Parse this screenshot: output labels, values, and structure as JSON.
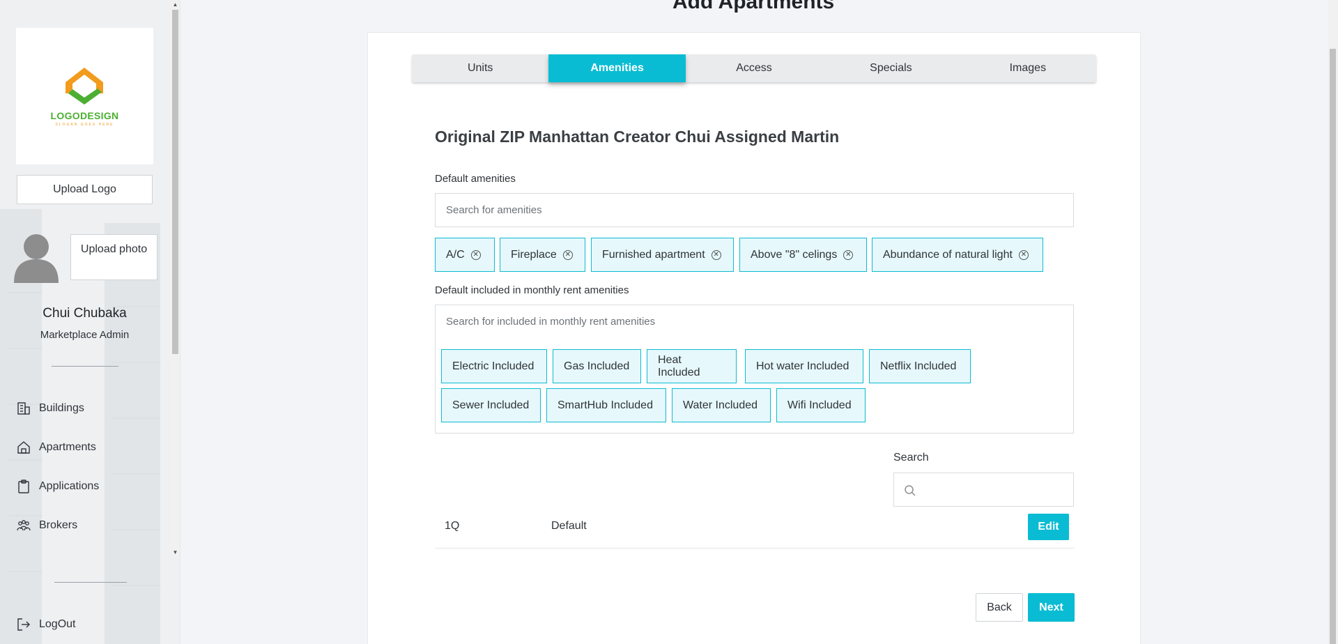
{
  "sidebar": {
    "logo": {
      "text": "LOGODESIGN",
      "sub": "SLOGAN GOES HERE"
    },
    "upload_logo_label": "Upload Logo",
    "upload_photo_label": "Upload photo",
    "user_name": "Chui Chubaka",
    "user_role": "Marketplace Admin",
    "nav": [
      {
        "label": "Buildings",
        "icon": "building-icon"
      },
      {
        "label": "Apartments",
        "icon": "home-icon"
      },
      {
        "label": "Applications",
        "icon": "clipboard-icon"
      },
      {
        "label": "Brokers",
        "icon": "people-icon"
      }
    ],
    "logout_label": "LogOut"
  },
  "page": {
    "title": "Add Apartments",
    "tabs": [
      {
        "label": "Units",
        "active": false
      },
      {
        "label": "Amenities",
        "active": true
      },
      {
        "label": "Access",
        "active": false
      },
      {
        "label": "Specials",
        "active": false
      },
      {
        "label": "Images",
        "active": false
      }
    ],
    "section_title": "Original ZIP Manhattan Creator Chui Assigned Martin",
    "default_amenities": {
      "label": "Default amenities",
      "placeholder": "Search for amenities",
      "chips": [
        "A/C",
        "Fireplace",
        "Furnished apartment",
        "Above \"8\" celings",
        "Abundance of natural light"
      ]
    },
    "included_amenities": {
      "label": "Default included in monthly rent amenities",
      "placeholder": "Search for included in monthly rent amenities",
      "chips_row1": [
        "Electric Included",
        "Gas Included",
        "Heat Included",
        "Hot water Included",
        "Netflix Included"
      ],
      "chips_row2": [
        "Sewer Included",
        "SmartHub Included",
        "Water Included",
        "Wifi Included"
      ]
    },
    "search": {
      "label": "Search",
      "placeholder": ""
    },
    "table": {
      "rows": [
        {
          "unit": "1Q",
          "type": "Default",
          "action": "Edit"
        }
      ]
    },
    "buttons": {
      "back": "Back",
      "next": "Next"
    }
  },
  "colors": {
    "accent": "#0abcd3",
    "chip_bg": "#e6f8fb",
    "logo_green": "#4caf32",
    "logo_orange": "#f29b1d"
  }
}
